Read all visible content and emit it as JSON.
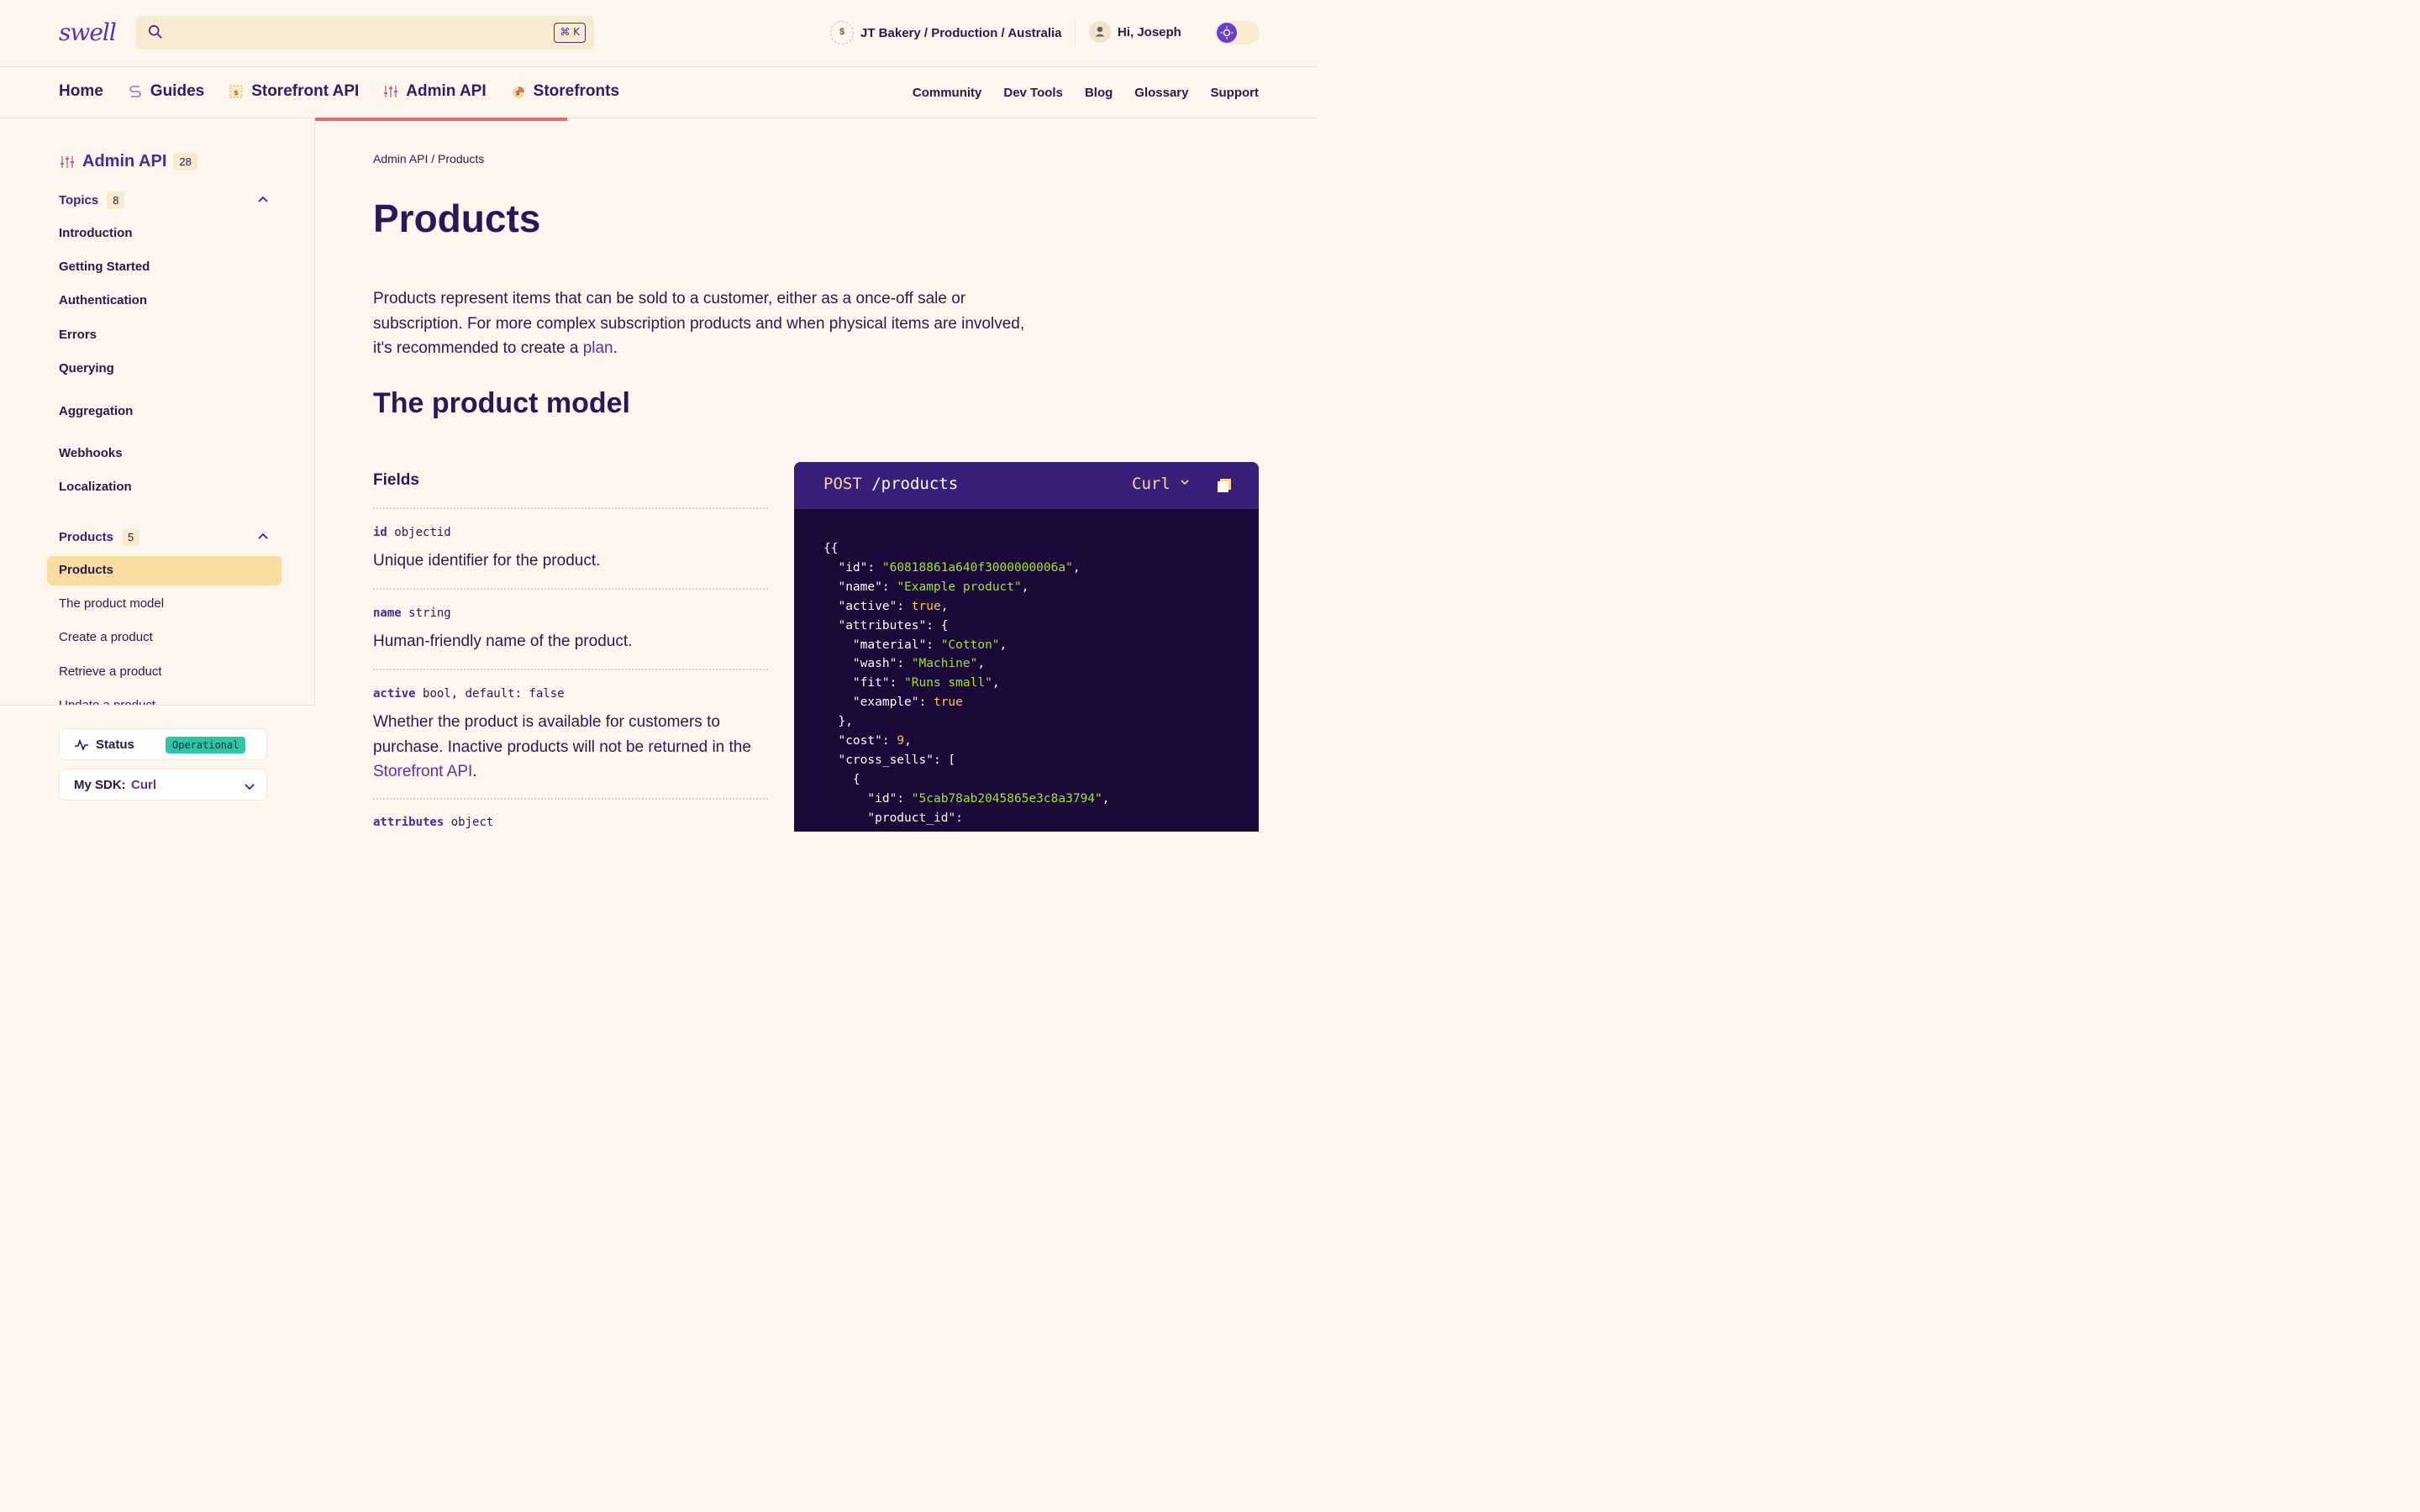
{
  "header": {
    "logo": "swell",
    "search_shortcut": "⌘ K",
    "store": "JT Bakery / Production / Australia",
    "store_icon": "$",
    "greeting": "Hi, Joseph"
  },
  "nav": {
    "left": [
      {
        "label": "Home",
        "icon": ""
      },
      {
        "label": "Guides",
        "icon": "guides-icon"
      },
      {
        "label": "Storefront API",
        "icon": "storefront-api-icon"
      },
      {
        "label": "Admin API",
        "icon": "admin-api-icon"
      },
      {
        "label": "Storefronts",
        "icon": "storefronts-icon"
      }
    ],
    "right": [
      "Community",
      "Dev Tools",
      "Blog",
      "Glossary",
      "Support"
    ]
  },
  "sidebar": {
    "title": "Admin API",
    "title_count": "28",
    "topics_label": "Topics",
    "topics_count": "8",
    "topics": [
      "Introduction",
      "Getting Started",
      "Authentication",
      "Errors",
      "Querying",
      "Aggregation",
      "Webhooks",
      "Localization"
    ],
    "products_label": "Products",
    "products_count": "5",
    "products": [
      "Products",
      "The product model",
      "Create a product",
      "Retrieve a product",
      "Update a product"
    ],
    "status_label": "Status",
    "status_value": "Operational",
    "sdk_label": "My SDK:",
    "sdk_value": "Curl"
  },
  "main": {
    "breadcrumb": "Admin API / Products",
    "title": "Products",
    "intro_1": "Products represent items that can be sold to a customer, either as a once-off sale or subscription. For more complex subscription products and when physical items are involved, it's recommended to create a ",
    "intro_link": "plan",
    "intro_2": ".",
    "model_heading": "The product model",
    "fields_heading": "Fields",
    "fields": [
      {
        "name": "id",
        "type": "objectid",
        "desc": "Unique identifier for the product."
      },
      {
        "name": "name",
        "type": "string",
        "desc": "Human-friendly name of the product."
      },
      {
        "name": "active",
        "type": "bool, default: false",
        "desc_1": "Whether the product is available for customers to purchase. Inactive products will not be returned in the ",
        "desc_link": "Storefront API",
        "desc_2": "."
      },
      {
        "name": "attributes",
        "type": "object"
      }
    ]
  },
  "code": {
    "method": "POST",
    "path": "/products",
    "lang": "Curl"
  },
  "colors": {
    "accent": "#5b2fb8",
    "active_tab_underline": "#e86b6e",
    "active_sidebar_item": "#fbdca0",
    "status_operational": "#2cc6a9",
    "code_bg": "#1a0938"
  }
}
